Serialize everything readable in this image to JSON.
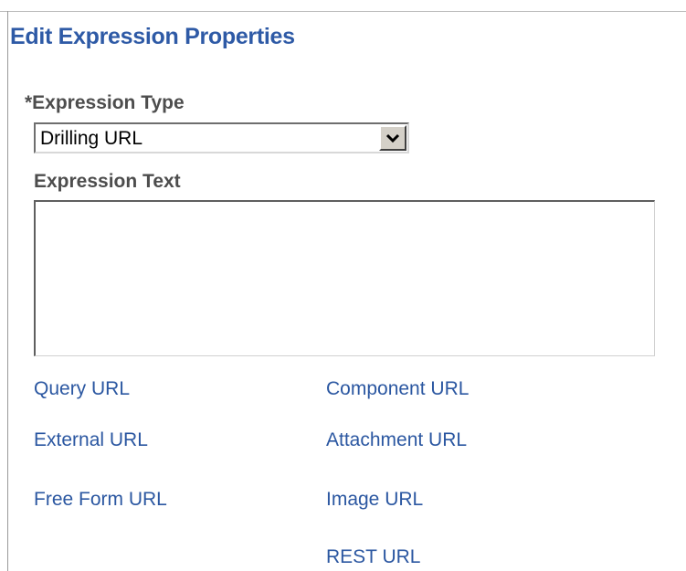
{
  "page": {
    "title": "Edit Expression Properties"
  },
  "form": {
    "expression_type": {
      "label": "*Expression Type",
      "selected": "Drilling URL"
    },
    "expression_text": {
      "label": "Expression Text",
      "value": ""
    }
  },
  "links": {
    "query_url": "Query URL",
    "component_url": "Component URL",
    "external_url": "External URL",
    "attachment_url": "Attachment URL",
    "free_form_url": "Free Form URL",
    "image_url": "Image URL",
    "rest_url": "REST URL"
  },
  "colors": {
    "title": "#2e5aa6",
    "link": "#2b57a1",
    "label": "#4d4d4d"
  },
  "icons": {
    "dropdown": "chevron-down-icon"
  }
}
